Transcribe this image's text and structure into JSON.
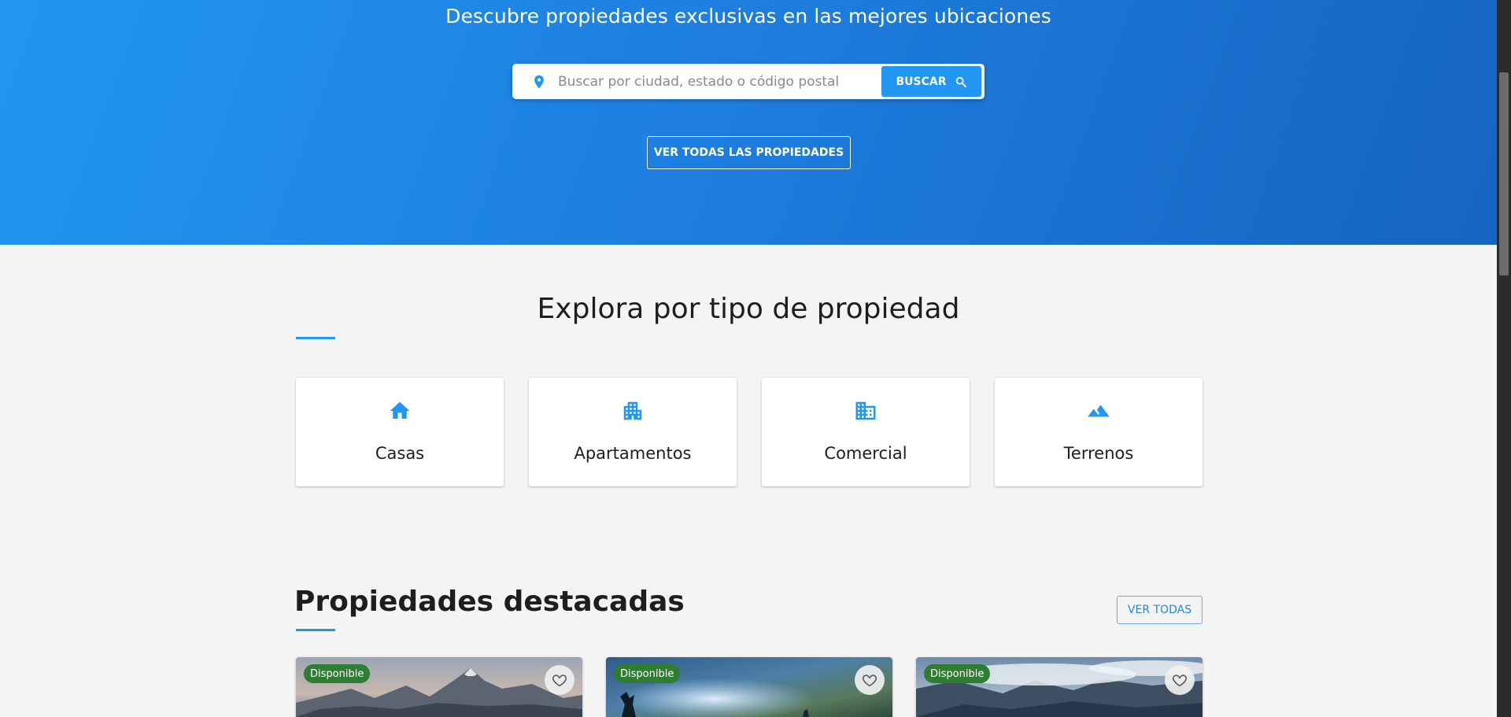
{
  "hero": {
    "subtitle": "Descubre propiedades exclusivas en las mejores ubicaciones",
    "search": {
      "placeholder": "Buscar por ciudad, estado o código postal",
      "value": "",
      "button_label": "BUSCAR",
      "pin_icon": "location-pin-icon",
      "button_icon": "search-icon"
    },
    "all_properties_label": "VER TODAS LAS PROPIEDADES"
  },
  "explore": {
    "title": "Explora por tipo de propiedad",
    "types": [
      {
        "label": "Casas",
        "icon": "home-icon"
      },
      {
        "label": "Apartamentos",
        "icon": "apartment-icon"
      },
      {
        "label": "Comercial",
        "icon": "business-icon"
      },
      {
        "label": "Terrenos",
        "icon": "landscape-icon"
      }
    ]
  },
  "featured": {
    "title": "Propiedades destacadas",
    "see_all_label": "VER TODAS",
    "properties": [
      {
        "status": "Disponible",
        "fav_icon": "heart-outline-icon"
      },
      {
        "status": "Disponible",
        "fav_icon": "heart-outline-icon"
      },
      {
        "status": "Disponible",
        "fav_icon": "heart-outline-icon"
      }
    ]
  },
  "colors": {
    "primary": "#2196f3",
    "hero_gradient_end": "#1565c0",
    "status_available": "#2e7d32",
    "background": "#f4f4f4"
  }
}
